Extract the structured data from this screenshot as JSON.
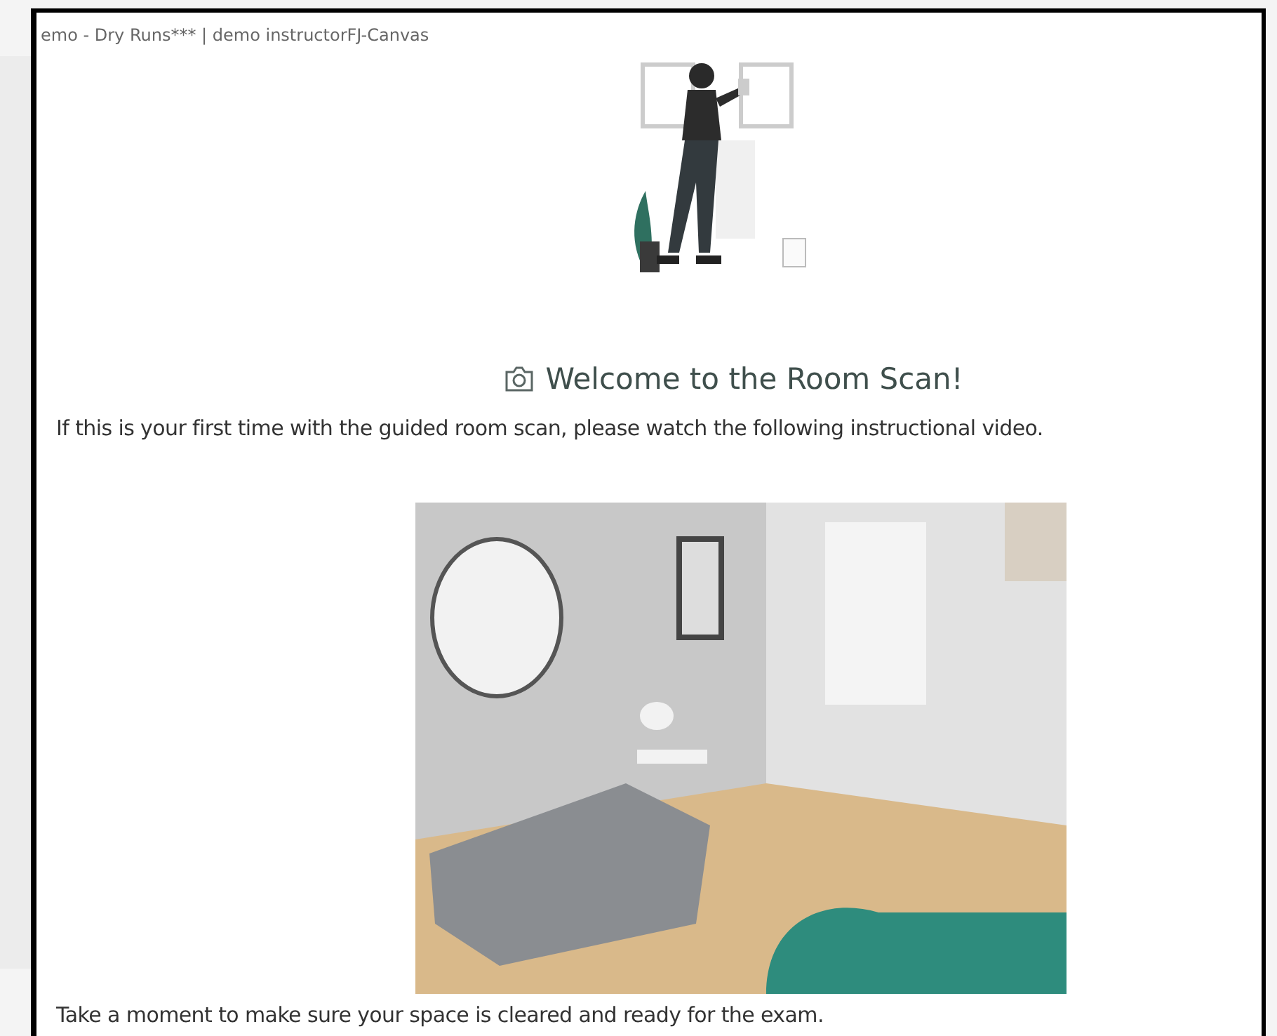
{
  "breadcrumb": "emo - Dry Runs*** | demo instructorFJ-Canvas",
  "heading": "Welcome to the Room Scan!",
  "intro": "If this is your first time with the guided room scan, please watch the following instructional video.",
  "footer_text": "Take a moment to make sure your space is cleared and ready for the exam."
}
